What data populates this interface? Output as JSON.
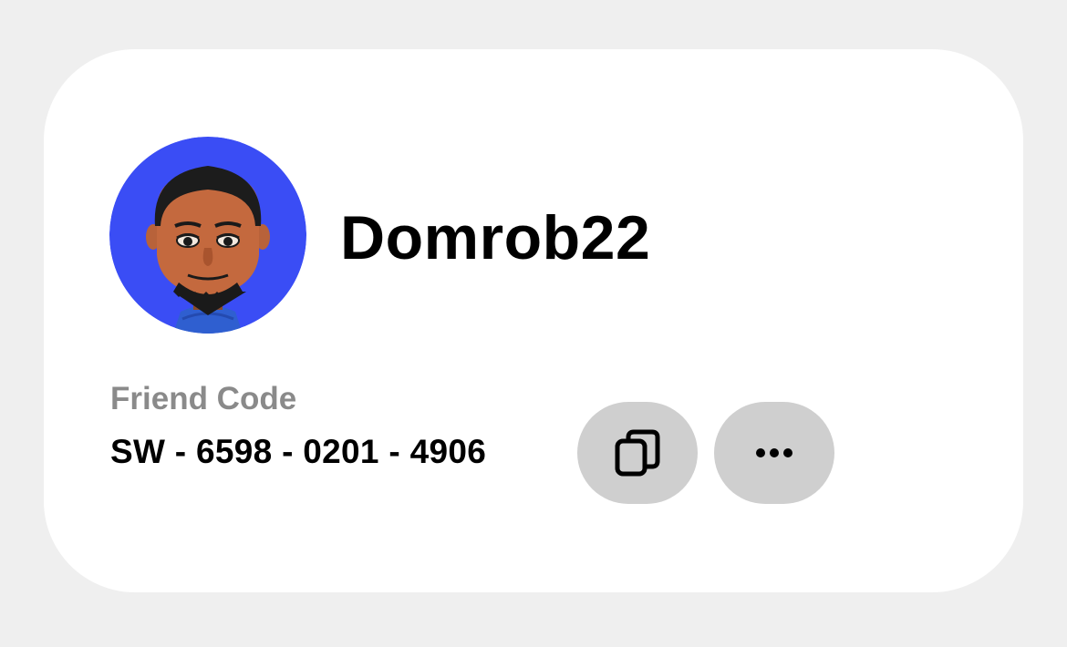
{
  "profile": {
    "username": "Domrob22",
    "avatar_icon": "mii-avatar",
    "avatar_bg_color": "#3a4df5"
  },
  "friend_code": {
    "label": "Friend Code",
    "value": "SW - 6598 - 0201 - 4906"
  },
  "actions": {
    "copy_icon": "copy-icon",
    "more_icon": "ellipsis-icon"
  },
  "colors": {
    "background": "#efefef",
    "card": "#ffffff",
    "button": "#cfcfcf",
    "label": "#8a8a8a",
    "text": "#000000"
  }
}
